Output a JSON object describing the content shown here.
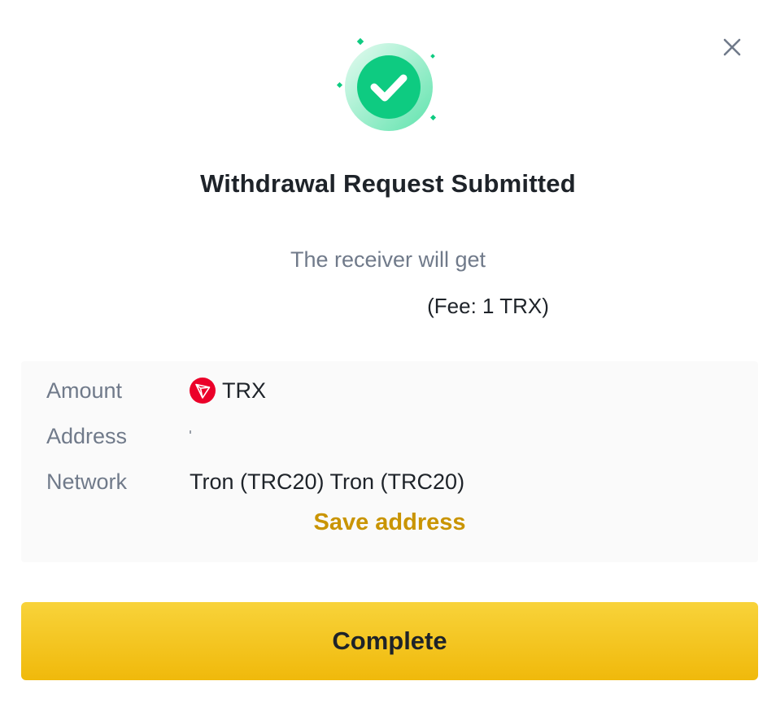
{
  "dialog": {
    "close_icon": "close-icon",
    "status_icon": "check-circle-icon",
    "title": "Withdrawal Request Submitted",
    "receiver_label": "The receiver will get",
    "fee_text": "(Fee: 1 TRX)"
  },
  "details": {
    "amount": {
      "label": "Amount",
      "coin_icon": "trx-coin-icon",
      "value": "TRX"
    },
    "address": {
      "label": "Address",
      "value": ""
    },
    "network": {
      "label": "Network",
      "value": "Tron (TRC20) Tron (TRC20)"
    },
    "save_address_label": "Save address"
  },
  "actions": {
    "complete_label": "Complete"
  },
  "colors": {
    "accent_yellow": "#F0B90B",
    "link_gold": "#C99400",
    "success_green": "#0ECB81",
    "trx_red": "#EB0029",
    "muted_text": "#707A8A",
    "primary_text": "#1E2329",
    "panel_bg": "#FAFAFA"
  }
}
